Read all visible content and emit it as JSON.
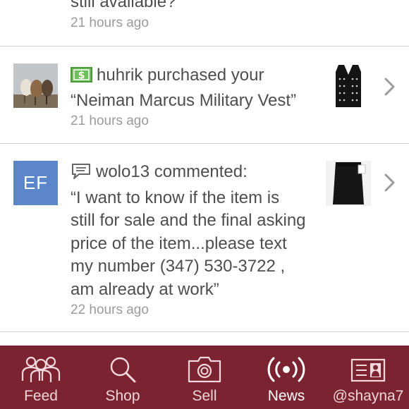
{
  "feed": {
    "top_card": {
      "text_partial": "still available?",
      "time": "21 hours ago"
    },
    "purchase_card": {
      "username": "huhrik",
      "message_suffix": " purchased your",
      "item": "“Neiman Marcus Military Vest”",
      "time": "21 hours ago"
    },
    "comment_card": {
      "initials": "EF",
      "username": "wolo13",
      "action": " commented:",
      "lines": [
        "“I want to know if the item is",
        "still for sale and the final asking",
        "price of the item...please text",
        "my number (347) 530-3722 ,",
        "am already at work”"
      ],
      "time": "22 hours ago"
    }
  },
  "tabbar": {
    "accent_color": "#7b2330",
    "tabs": [
      {
        "label": "Feed",
        "icon": "people-icon"
      },
      {
        "label": "Shop",
        "icon": "search-icon"
      },
      {
        "label": "Sell",
        "icon": "camera-icon"
      },
      {
        "label": "News",
        "icon": "broadcast-icon",
        "active": true
      },
      {
        "label": "@shayna7",
        "icon": "profile-card-icon"
      }
    ]
  }
}
